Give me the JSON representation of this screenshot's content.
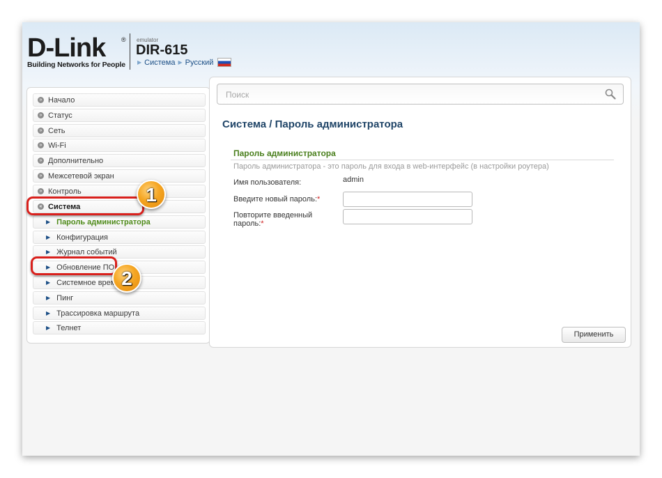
{
  "header": {
    "brand_word": "D-Link",
    "brand_reg": "®",
    "tagline": "Building Networks for People",
    "emulator_label": "emulator",
    "model": "DIR-615",
    "crumbs": [
      "Система",
      "Русский"
    ]
  },
  "search": {
    "placeholder": "Поиск"
  },
  "sidebar": {
    "items": [
      {
        "label": "Начало"
      },
      {
        "label": "Статус"
      },
      {
        "label": "Сеть"
      },
      {
        "label": "Wi-Fi"
      },
      {
        "label": "Дополнительно"
      },
      {
        "label": "Межсетевой экран"
      },
      {
        "label": "Контроль"
      },
      {
        "label": "Система"
      }
    ],
    "subitems": [
      {
        "label": "Пароль администратора"
      },
      {
        "label": "Конфигурация"
      },
      {
        "label": "Журнал событий"
      },
      {
        "label": "Обновление ПО"
      },
      {
        "label": "Системное время"
      },
      {
        "label": "Пинг"
      },
      {
        "label": "Трассировка маршрута"
      },
      {
        "label": "Телнет"
      }
    ]
  },
  "main": {
    "breadcrumb_root": "Система /",
    "page_title": "Пароль администратора",
    "section_title": "Пароль администратора",
    "section_desc": "Пароль администратора - это пароль для входа в web-интерфейс (в настройки роутера)",
    "username_label": "Имя пользователя:",
    "username_value": "admin",
    "new_password_label": "Введите новый пароль:",
    "repeat_password_label": "Повторите введенный",
    "repeat_password_label2": "пароль:",
    "required_mark": "*",
    "apply_button": "Применить"
  },
  "annotations": {
    "badge1": "1",
    "badge2": "2"
  },
  "colors": {
    "accent": "#1f4467",
    "section": "#4a7f1d",
    "highlight": "#d9201c",
    "badge": "#f5a623"
  }
}
